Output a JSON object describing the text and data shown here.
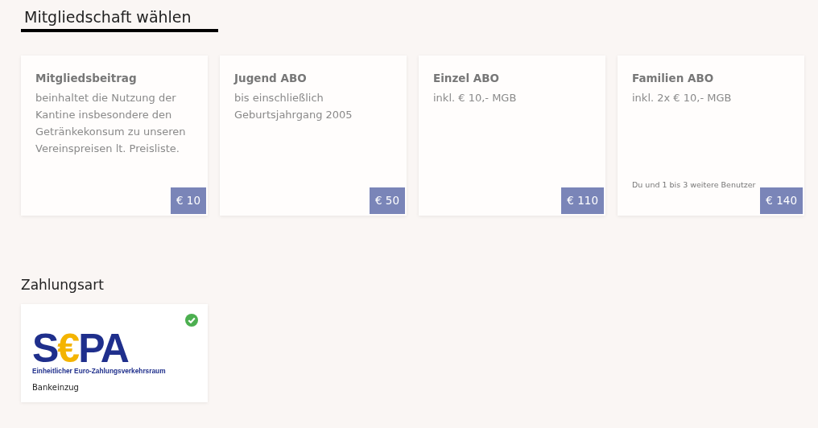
{
  "membership": {
    "title": "Mitgliedschaft wählen",
    "plans": [
      {
        "name": "Mitgliedsbeitrag",
        "description": "beinhaltet die Nutzung der Kantine insbesondere den Getränkekonsum zu unseren Vereinspreisen lt. Preisliste.",
        "price": "€ 10",
        "selected": false
      },
      {
        "name": "Jugend ABO",
        "description": "bis einschließlich Geburtsjahrgang 2005",
        "price": "€ 50",
        "selected": false
      },
      {
        "name": "Einzel ABO",
        "description": "inkl. € 10,- MGB",
        "price": "€ 110",
        "selected": false
      },
      {
        "name": "Familien ABO",
        "description": "inkl. 2x € 10,- MGB",
        "note": "Du und 1 bis 3 weitere Benutzer",
        "price": "€ 140",
        "selected": false
      }
    ]
  },
  "payment": {
    "title": "Zahlungsart",
    "methods": [
      {
        "logo_parts": [
          {
            "text": "S",
            "color": "#1f2f8c"
          },
          {
            "text": "€",
            "color": "#f4b400"
          },
          {
            "text": "PA",
            "color": "#1f2f8c"
          }
        ],
        "logo_tagline": "Einheitlicher Euro-Zahlungsverkehrsraum",
        "label": "Bankeinzug",
        "selected": true
      }
    ]
  }
}
